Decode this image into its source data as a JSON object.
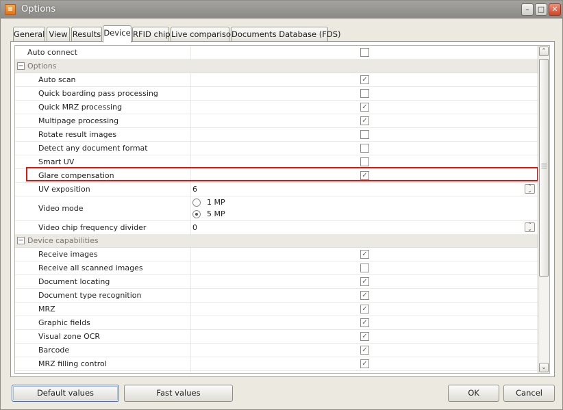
{
  "window": {
    "title": "Options",
    "icon": "app-logo-icon",
    "controls": [
      "minimize-icon",
      "maximize-icon",
      "close-icon"
    ]
  },
  "tabs": [
    {
      "label": "General",
      "active": false
    },
    {
      "label": "View",
      "active": false
    },
    {
      "label": "Results",
      "active": false
    },
    {
      "label": "Device",
      "active": true
    },
    {
      "label": "RFID chip",
      "active": false
    },
    {
      "label": "Live comparison",
      "active": false
    },
    {
      "label": "Documents Database (FDS)",
      "active": false
    }
  ],
  "grid": {
    "auto_connect": {
      "label": "Auto connect",
      "checked": false
    },
    "options_group": {
      "title": "Options",
      "items": [
        {
          "label": "Auto scan",
          "checked": true
        },
        {
          "label": "Quick boarding pass processing",
          "checked": false
        },
        {
          "label": "Quick MRZ processing",
          "checked": true
        },
        {
          "label": "Multipage processing",
          "checked": true
        },
        {
          "label": "Rotate result images",
          "checked": false
        },
        {
          "label": "Detect any document format",
          "checked": false
        },
        {
          "label": "Smart UV",
          "checked": false
        },
        {
          "label": "Glare compensation",
          "checked": true
        }
      ],
      "uv_exposition": {
        "label": "UV exposition",
        "value": "6"
      },
      "video_mode": {
        "label": "Video mode",
        "options": [
          "1 MP",
          "5 MP"
        ],
        "selected": "5 MP"
      },
      "video_chip_divider": {
        "label": "Video chip frequency divider",
        "value": "0"
      }
    },
    "capabilities_group": {
      "title": "Device capabilities",
      "items": [
        {
          "label": "Receive images",
          "checked": true
        },
        {
          "label": "Receive all scanned images",
          "checked": false
        },
        {
          "label": "Document locating",
          "checked": true
        },
        {
          "label": "Document type recognition",
          "checked": true
        },
        {
          "label": "MRZ",
          "checked": true
        },
        {
          "label": "Graphic fields",
          "checked": true
        },
        {
          "label": "Visual zone OCR",
          "checked": true
        },
        {
          "label": "Barcode",
          "checked": true
        },
        {
          "label": "MRZ filling control",
          "checked": true
        }
      ]
    }
  },
  "buttons": {
    "default_values": "Default values",
    "fast_values": "Fast values",
    "ok": "OK",
    "cancel": "Cancel"
  },
  "colors": {
    "highlight": "#e3120b",
    "group_bg": "#ebe9e3"
  }
}
